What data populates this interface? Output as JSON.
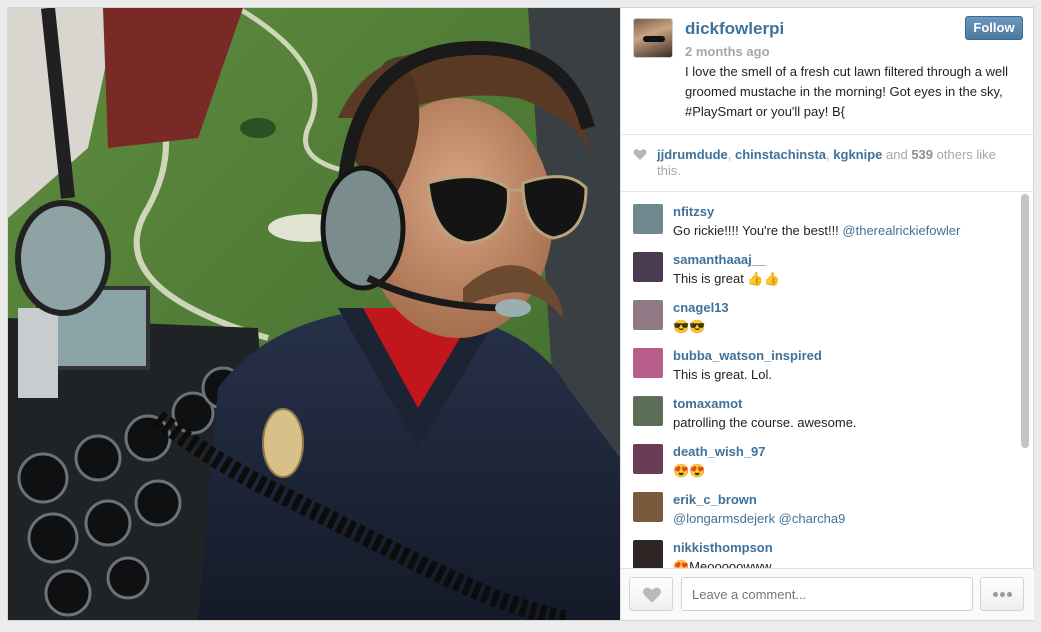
{
  "post": {
    "username": "dickfowlerpi",
    "time": "2 months ago",
    "caption": "I love the smell of a fresh cut lawn filtered through a well groomed mustache in the morning! Got eyes in the sky, #PlaySmart or you'll pay! B{",
    "follow_label": "Follow"
  },
  "likes": {
    "users": [
      "jjdrumdude",
      "chinstachinsta",
      "kgknipe"
    ],
    "sep1": ", ",
    "sep2": ", ",
    "and_text": " and ",
    "count": "539",
    "suffix": " others like this."
  },
  "comments": [
    {
      "user": "nfitzsy",
      "text": "Go rickie!!!! You're the best!!! ",
      "mention": "@therealrickiefowler",
      "color": "#6f8a8f"
    },
    {
      "user": "samanthaaaj__",
      "text": "This is great 👍👍",
      "mention": "",
      "color": "#4a3a52"
    },
    {
      "user": "cnagel13",
      "text": "😎😎",
      "mention": "",
      "color": "#8f7a86"
    },
    {
      "user": "bubba_watson_inspired",
      "text": "This is great. Lol.",
      "mention": "",
      "color": "#b65d8a"
    },
    {
      "user": "tomaxamot",
      "text": "patrolling the course. awesome.",
      "mention": "",
      "color": "#5e6f57"
    },
    {
      "user": "death_wish_97",
      "text": "😍😍",
      "mention": "",
      "color": "#6b3b55"
    },
    {
      "user": "erik_c_brown",
      "text": "",
      "mention": "@longarmsdejerk @charcha9",
      "color": "#7a5a3c"
    },
    {
      "user": "nikkisthompson",
      "text": "😍Meooooowww",
      "mention": "",
      "color": "#2e2624"
    }
  ],
  "footer": {
    "comment_placeholder": "Leave a comment..."
  },
  "colors": {
    "link": "#3f729b",
    "follow": "#4b7aa0"
  }
}
